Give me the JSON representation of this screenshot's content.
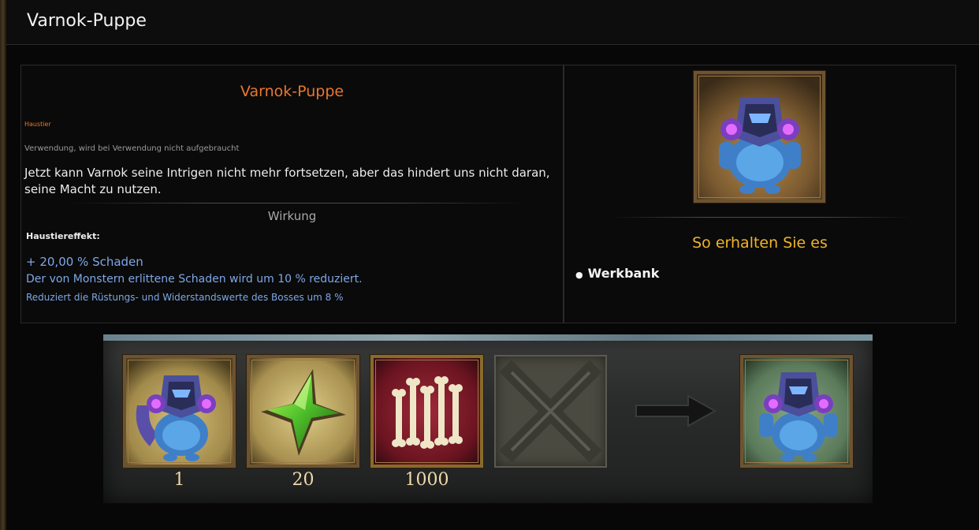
{
  "header": {
    "title": "Varnok-Puppe"
  },
  "item": {
    "name": "Varnok-Puppe",
    "type": "Haustier",
    "usage": "Verwendung, wird bei Verwendung nicht aufgebraucht",
    "description": "Jetzt kann Varnok seine Intrigen nicht mehr fortsetzen, aber das hindert uns nicht daran, seine Macht zu nutzen.",
    "effect_heading": "Wirkung",
    "effect_label": "Haustiereffekt:",
    "effects": [
      "+ 20,00 % Schaden",
      "Der von Monstern erlittene Schaden wird um 10 % reduziert.",
      "Reduziert die Rüstungs- und Widerstandswerte des Bosses um 8 %"
    ]
  },
  "obtain": {
    "heading": "So erhalten Sie es",
    "sources": [
      "Werkbank"
    ]
  },
  "crafting": {
    "ingredients": [
      {
        "icon": "varnok-doll-icon",
        "quantity": "1"
      },
      {
        "icon": "green-star-gem-icon",
        "quantity": "20"
      },
      {
        "icon": "bones-icon",
        "quantity": "1000"
      },
      {
        "icon": "empty-slot-icon",
        "quantity": ""
      }
    ],
    "arrow_icon": "arrow-right-icon",
    "result_icon": "varnok-doll-icon"
  },
  "colors": {
    "item_name": "#e8772e",
    "obtain_heading": "#f0b429",
    "effect_text": "#7ea7e6"
  }
}
